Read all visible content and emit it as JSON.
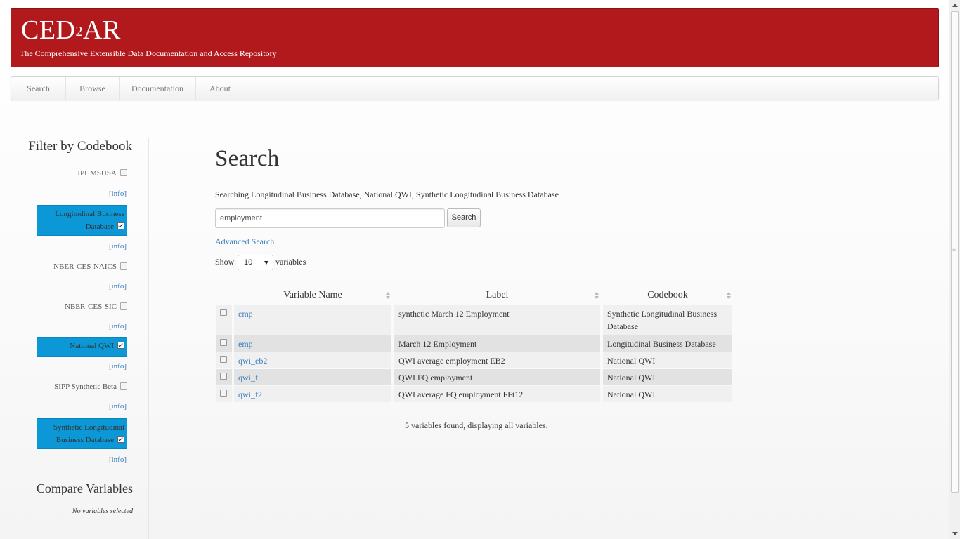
{
  "header": {
    "logo_text": "CED",
    "logo_sup": "2",
    "logo_text_end": "AR",
    "tagline": "The Comprehensive Extensible Data Documentation and Access Repository"
  },
  "nav": {
    "items": [
      {
        "label": "Search"
      },
      {
        "label": "Browse"
      },
      {
        "label": "Documentation"
      },
      {
        "label": "About"
      }
    ]
  },
  "sidebar": {
    "title": "Filter by Codebook",
    "info_label": "[info]",
    "codebooks": [
      {
        "name": "IPUMSUSA",
        "checked": false
      },
      {
        "name_line1": "Longitudinal Business",
        "name_line2": "Database",
        "checked": true
      },
      {
        "name": "NBER-CES-NAICS",
        "checked": false
      },
      {
        "name": "NBER-CES-SIC",
        "checked": false
      },
      {
        "name": "National QWI",
        "checked": true
      },
      {
        "name": "SIPP Synthetic Beta",
        "checked": false
      },
      {
        "name_line1": "Synthetic Longitudinal",
        "name_line2": "Business Database",
        "checked": true
      }
    ],
    "compare_title": "Compare Variables",
    "compare_empty": "No variables selected"
  },
  "main": {
    "title": "Search",
    "searching_text": "Searching Longitudinal Business Database, National QWI, Synthetic Longitudinal Business Database",
    "search_value": "employment",
    "search_button": "Search",
    "advanced_link": "Advanced Search",
    "show_label": "Show",
    "show_value": "10",
    "variables_label": "variables",
    "summary": "5 variables found, displaying all variables."
  },
  "table": {
    "columns": [
      "Variable Name",
      "Label",
      "Codebook"
    ],
    "rows": [
      {
        "name": "emp",
        "label": "synthetic March 12 Employment",
        "codebook_line1": "Synthetic Longitudinal Business",
        "codebook_line2": "Database"
      },
      {
        "name": "emp",
        "label": "March 12 Employment",
        "codebook": "Longitudinal Business Database"
      },
      {
        "name": "qwi_eb2",
        "label": "QWI average employment EB2",
        "codebook": "National QWI"
      },
      {
        "name": "qwi_f",
        "label": "QWI FQ employment",
        "codebook": "National QWI"
      },
      {
        "name": "qwi_f2",
        "label": "QWI average FQ employment FFt12",
        "codebook": "National QWI"
      }
    ]
  },
  "colors": {
    "brand_red": "#b2191c",
    "selected_blue": "#0c97d6",
    "link_blue": "#3a7ebf"
  }
}
